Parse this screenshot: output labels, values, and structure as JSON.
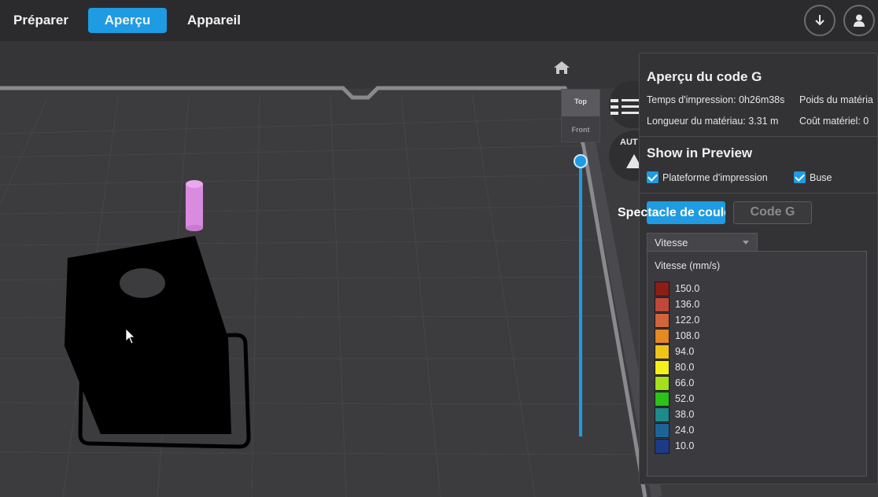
{
  "nav": {
    "tabs": [
      {
        "label": "Préparer"
      },
      {
        "label": "Aperçu"
      },
      {
        "label": "Appareil"
      }
    ],
    "icons": [
      "download-icon",
      "user-icon"
    ]
  },
  "viewcube": {
    "top": "Top",
    "front": "Front"
  },
  "side_button_partial": "AUT",
  "panel": {
    "title": "Aperçu du code G",
    "print_time": "Temps d'impression: 0h26m38s",
    "material_weight": "Poids du matéria",
    "material_length": "Longueur du matériau: 3.31 m",
    "material_cost": "Coût matériel: 0",
    "show_title": "Show in Preview",
    "checkbox_platform": "Plateforme d'impression",
    "checkbox_nozzle": "Buse",
    "btn_color": "Spectacle de couleur",
    "btn_gcode": "Code G",
    "dropdown_value": "Vitesse",
    "legend_title": "Vitesse (mm/s)",
    "legend": [
      {
        "label": "150.0",
        "color": "#8c1d18"
      },
      {
        "label": "136.0",
        "color": "#c0483a"
      },
      {
        "label": "122.0",
        "color": "#d1643a"
      },
      {
        "label": "108.0",
        "color": "#e38a22"
      },
      {
        "label": "94.0",
        "color": "#eec419"
      },
      {
        "label": "80.0",
        "color": "#f4ef1b"
      },
      {
        "label": "66.0",
        "color": "#a6e01a"
      },
      {
        "label": "52.0",
        "color": "#2cc21a"
      },
      {
        "label": "38.0",
        "color": "#1e8a8a"
      },
      {
        "label": "24.0",
        "color": "#1d6496"
      },
      {
        "label": "10.0",
        "color": "#1c3a86"
      }
    ]
  },
  "colors": {
    "accent": "#1e9be2",
    "model": "#000000",
    "prime_tower": "#d98be0"
  }
}
